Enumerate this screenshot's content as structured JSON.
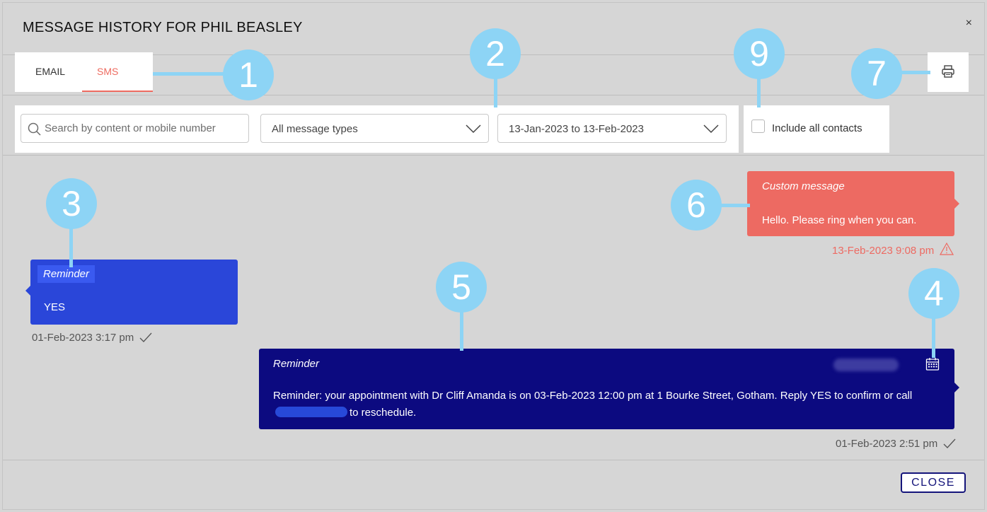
{
  "header": {
    "title": "MESSAGE HISTORY FOR PHIL BEASLEY",
    "close_glyph": "×"
  },
  "tabs": [
    {
      "label": "EMAIL",
      "active": false
    },
    {
      "label": "SMS",
      "active": true
    }
  ],
  "filters": {
    "search_placeholder": "Search by content or mobile number",
    "message_type": "All message types",
    "date_range": "13-Jan-2023 to 13-Feb-2023",
    "include_contacts_label": "Include all contacts",
    "include_contacts_checked": false
  },
  "messages": [
    {
      "type": "Reminder",
      "text": "YES",
      "timestamp": "01-Feb-2023 3:17 pm",
      "status": "delivered",
      "direction": "incoming",
      "color": "#2a46d9"
    },
    {
      "type": "Custom message",
      "text": "Hello. Please ring when you can.",
      "timestamp": "13-Feb-2023 9:08 pm",
      "status": "failed",
      "direction": "outgoing",
      "color": "#ed6a62"
    },
    {
      "type": "Reminder",
      "text_before": "Reminder: your appointment with Dr Cliff Amanda is on 03-Feb-2023 12:00 pm at 1 Bourke Street, Gotham. Reply YES to confirm or call",
      "text_after": "to reschedule.",
      "timestamp": "01-Feb-2023 2:51 pm",
      "status": "delivered",
      "direction": "outgoing",
      "color": "#0c0a80"
    }
  ],
  "callouts": [
    "1",
    "2",
    "3",
    "4",
    "5",
    "6",
    "7",
    "9"
  ],
  "footer": {
    "close_label": "CLOSE"
  },
  "colors": {
    "accent": "#ee6b60",
    "callout": "#8dd4f5",
    "primary_dark": "#14147a"
  },
  "icons": {
    "close": "close-icon",
    "search": "search-icon",
    "dropdown": "chevron-down-icon",
    "print": "printer-icon",
    "calendar": "calendar-icon",
    "delivered": "checkmark-icon",
    "failed": "warning-icon"
  }
}
